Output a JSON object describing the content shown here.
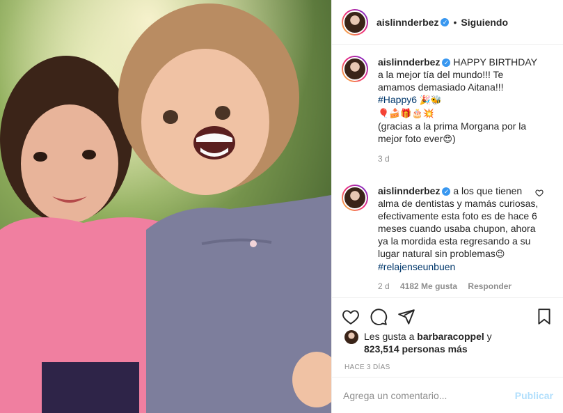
{
  "header": {
    "username": "aislinnderbez",
    "separator": "•",
    "follow_state": "Siguiendo"
  },
  "comments": [
    {
      "username": "aislinnderbez",
      "text_1": " HAPPY BIRTHDAY a la mejor tía del mundo!!! Te amamos demasiado Aitana!!! ",
      "hashtag": "#Happy6",
      "emojis_1": " 🎉🐝",
      "emojis_2": "🎈🍰🎁🎂💥",
      "text_2": "(gracias a la prima Morgana por la mejor foto ever",
      "emoji_end": "😍",
      "text_3": ")",
      "time": "3 d"
    },
    {
      "username": "aislinnderbez",
      "text_1": " a los que tienen alma de dentistas y mamás curiosas, efectivamente esta foto es de hace 6 meses cuando usaba chupon, ahora ya la mordida esta regresando a su lugar natural sin problemas",
      "emoji": "😉",
      "hashtag": " #relajenseunbuen",
      "time": "2 d",
      "likes": "4182 Me gusta",
      "reply": "Responder"
    }
  ],
  "likes": {
    "prefix": "Les gusta a ",
    "user": "barbaracoppel",
    "middle": " y",
    "count": "823,514 personas más"
  },
  "date": "HACE 3 DÍAS",
  "add_comment": {
    "placeholder": "Agrega un comentario...",
    "publish": "Publicar"
  }
}
